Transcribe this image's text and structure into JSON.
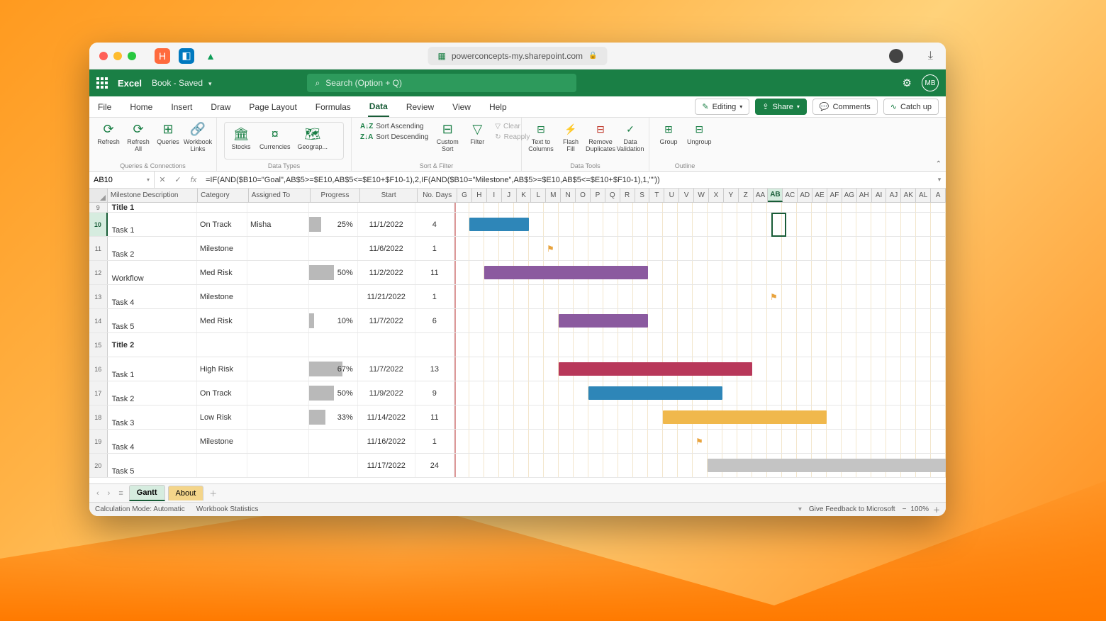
{
  "browser": {
    "url": "powerconcepts-my.sharepoint.com"
  },
  "titlebar": {
    "app": "Excel",
    "doc": "Book - Saved",
    "search_placeholder": "Search (Option + Q)",
    "avatar": "MB"
  },
  "menus": [
    "File",
    "Home",
    "Insert",
    "Draw",
    "Page Layout",
    "Formulas",
    "Data",
    "Review",
    "View",
    "Help"
  ],
  "menu_active": "Data",
  "menu_right": {
    "editing": "Editing",
    "share": "Share",
    "comments": "Comments",
    "catchup": "Catch up"
  },
  "ribbon": {
    "groups": {
      "qc": {
        "label": "Queries & Connections",
        "items": [
          "Refresh",
          "Refresh All",
          "Queries",
          "Workbook Links"
        ]
      },
      "dt": {
        "label": "Data Types",
        "items": [
          "Stocks",
          "Currencies",
          "Geograp..."
        ]
      },
      "sf": {
        "label": "Sort & Filter",
        "sort_asc": "Sort Ascending",
        "sort_desc": "Sort Descending",
        "custom": "Custom Sort",
        "filter": "Filter",
        "clear": "Clear",
        "reapply": "Reapply"
      },
      "tools": {
        "label": "Data Tools",
        "items": [
          "Text to Columns",
          "Flash Fill",
          "Remove Duplicates",
          "Data Validation"
        ]
      },
      "outline": {
        "label": "Outline",
        "items": [
          "Group",
          "Ungroup"
        ]
      }
    }
  },
  "namebox": "AB10",
  "formula": "=IF(AND($B10=\"Goal\",AB$5>=$E10,AB$5<=$E10+$F10-1),2,IF(AND($B10=\"Milestone\",AB$5>=$E10,AB$5<=$E10+$F10-1),1,\"\"))",
  "col_headers_wide": [
    "Milestone Description",
    "Category",
    "Assigned To",
    "Progress",
    "Start",
    "No. Days"
  ],
  "col_letters": [
    "G",
    "H",
    "I",
    "J",
    "K",
    "L",
    "M",
    "N",
    "O",
    "P",
    "Q",
    "R",
    "S",
    "T",
    "U",
    "V",
    "W",
    "X",
    "Y",
    "Z",
    "AA",
    "AB",
    "AC",
    "AD",
    "AE",
    "AF",
    "AG",
    "AH",
    "AI",
    "AJ",
    "AK",
    "AL",
    "A"
  ],
  "selected_col": "AB",
  "rows": [
    {
      "n": 9,
      "title": "Title 1",
      "short": true
    },
    {
      "n": 10,
      "desc": "Task 1",
      "cat": "On Track",
      "assigned": "Misha",
      "prog": 25,
      "start": "11/1/2022",
      "days": 4,
      "bar": {
        "from": 2,
        "len": 4,
        "color": "#2e86b8"
      },
      "selected_row": true
    },
    {
      "n": 11,
      "desc": "Task 2",
      "cat": "Milestone",
      "start": "11/6/2022",
      "days": 1,
      "flag_at": 7
    },
    {
      "n": 12,
      "desc": "Workflow",
      "cat": "Med Risk",
      "prog": 50,
      "start": "11/2/2022",
      "days": 11,
      "bar": {
        "from": 3,
        "len": 11,
        "color": "#8b5a9f"
      }
    },
    {
      "n": 13,
      "desc": "Task 4",
      "cat": "Milestone",
      "start": "11/21/2022",
      "days": 1,
      "flag_at": 22
    },
    {
      "n": 14,
      "desc": "Task 5",
      "cat": "Med Risk",
      "prog": 10,
      "start": "11/7/2022",
      "days": 6,
      "bar": {
        "from": 8,
        "len": 6,
        "color": "#8b5a9f"
      }
    },
    {
      "n": 15,
      "title": "Title 2"
    },
    {
      "n": 16,
      "desc": "Task 1",
      "cat": "High Risk",
      "prog": 67,
      "start": "11/7/2022",
      "days": 13,
      "bar": {
        "from": 8,
        "len": 13,
        "color": "#b8385a"
      }
    },
    {
      "n": 17,
      "desc": "Task 2",
      "cat": "On Track",
      "prog": 50,
      "start": "11/9/2022",
      "days": 9,
      "bar": {
        "from": 10,
        "len": 9,
        "color": "#2e86b8"
      }
    },
    {
      "n": 18,
      "desc": "Task 3",
      "cat": "Low Risk",
      "prog": 33,
      "start": "11/14/2022",
      "days": 11,
      "bar": {
        "from": 15,
        "len": 11,
        "color": "#f0b84c"
      }
    },
    {
      "n": 19,
      "desc": "Task 4",
      "cat": "Milestone",
      "start": "11/16/2022",
      "days": 1,
      "flag_at": 17
    },
    {
      "n": 20,
      "desc": "Task 5",
      "start": "11/17/2022",
      "days": 24,
      "bar": {
        "from": 18,
        "len": 24,
        "color": "#c4c4c4"
      },
      "truncated": true
    }
  ],
  "sheets": {
    "active": "Gantt",
    "other": "About"
  },
  "statusbar": {
    "calc": "Calculation Mode: Automatic",
    "stats": "Workbook Statistics",
    "feedback": "Give Feedback to Microsoft",
    "zoom": "100%"
  }
}
